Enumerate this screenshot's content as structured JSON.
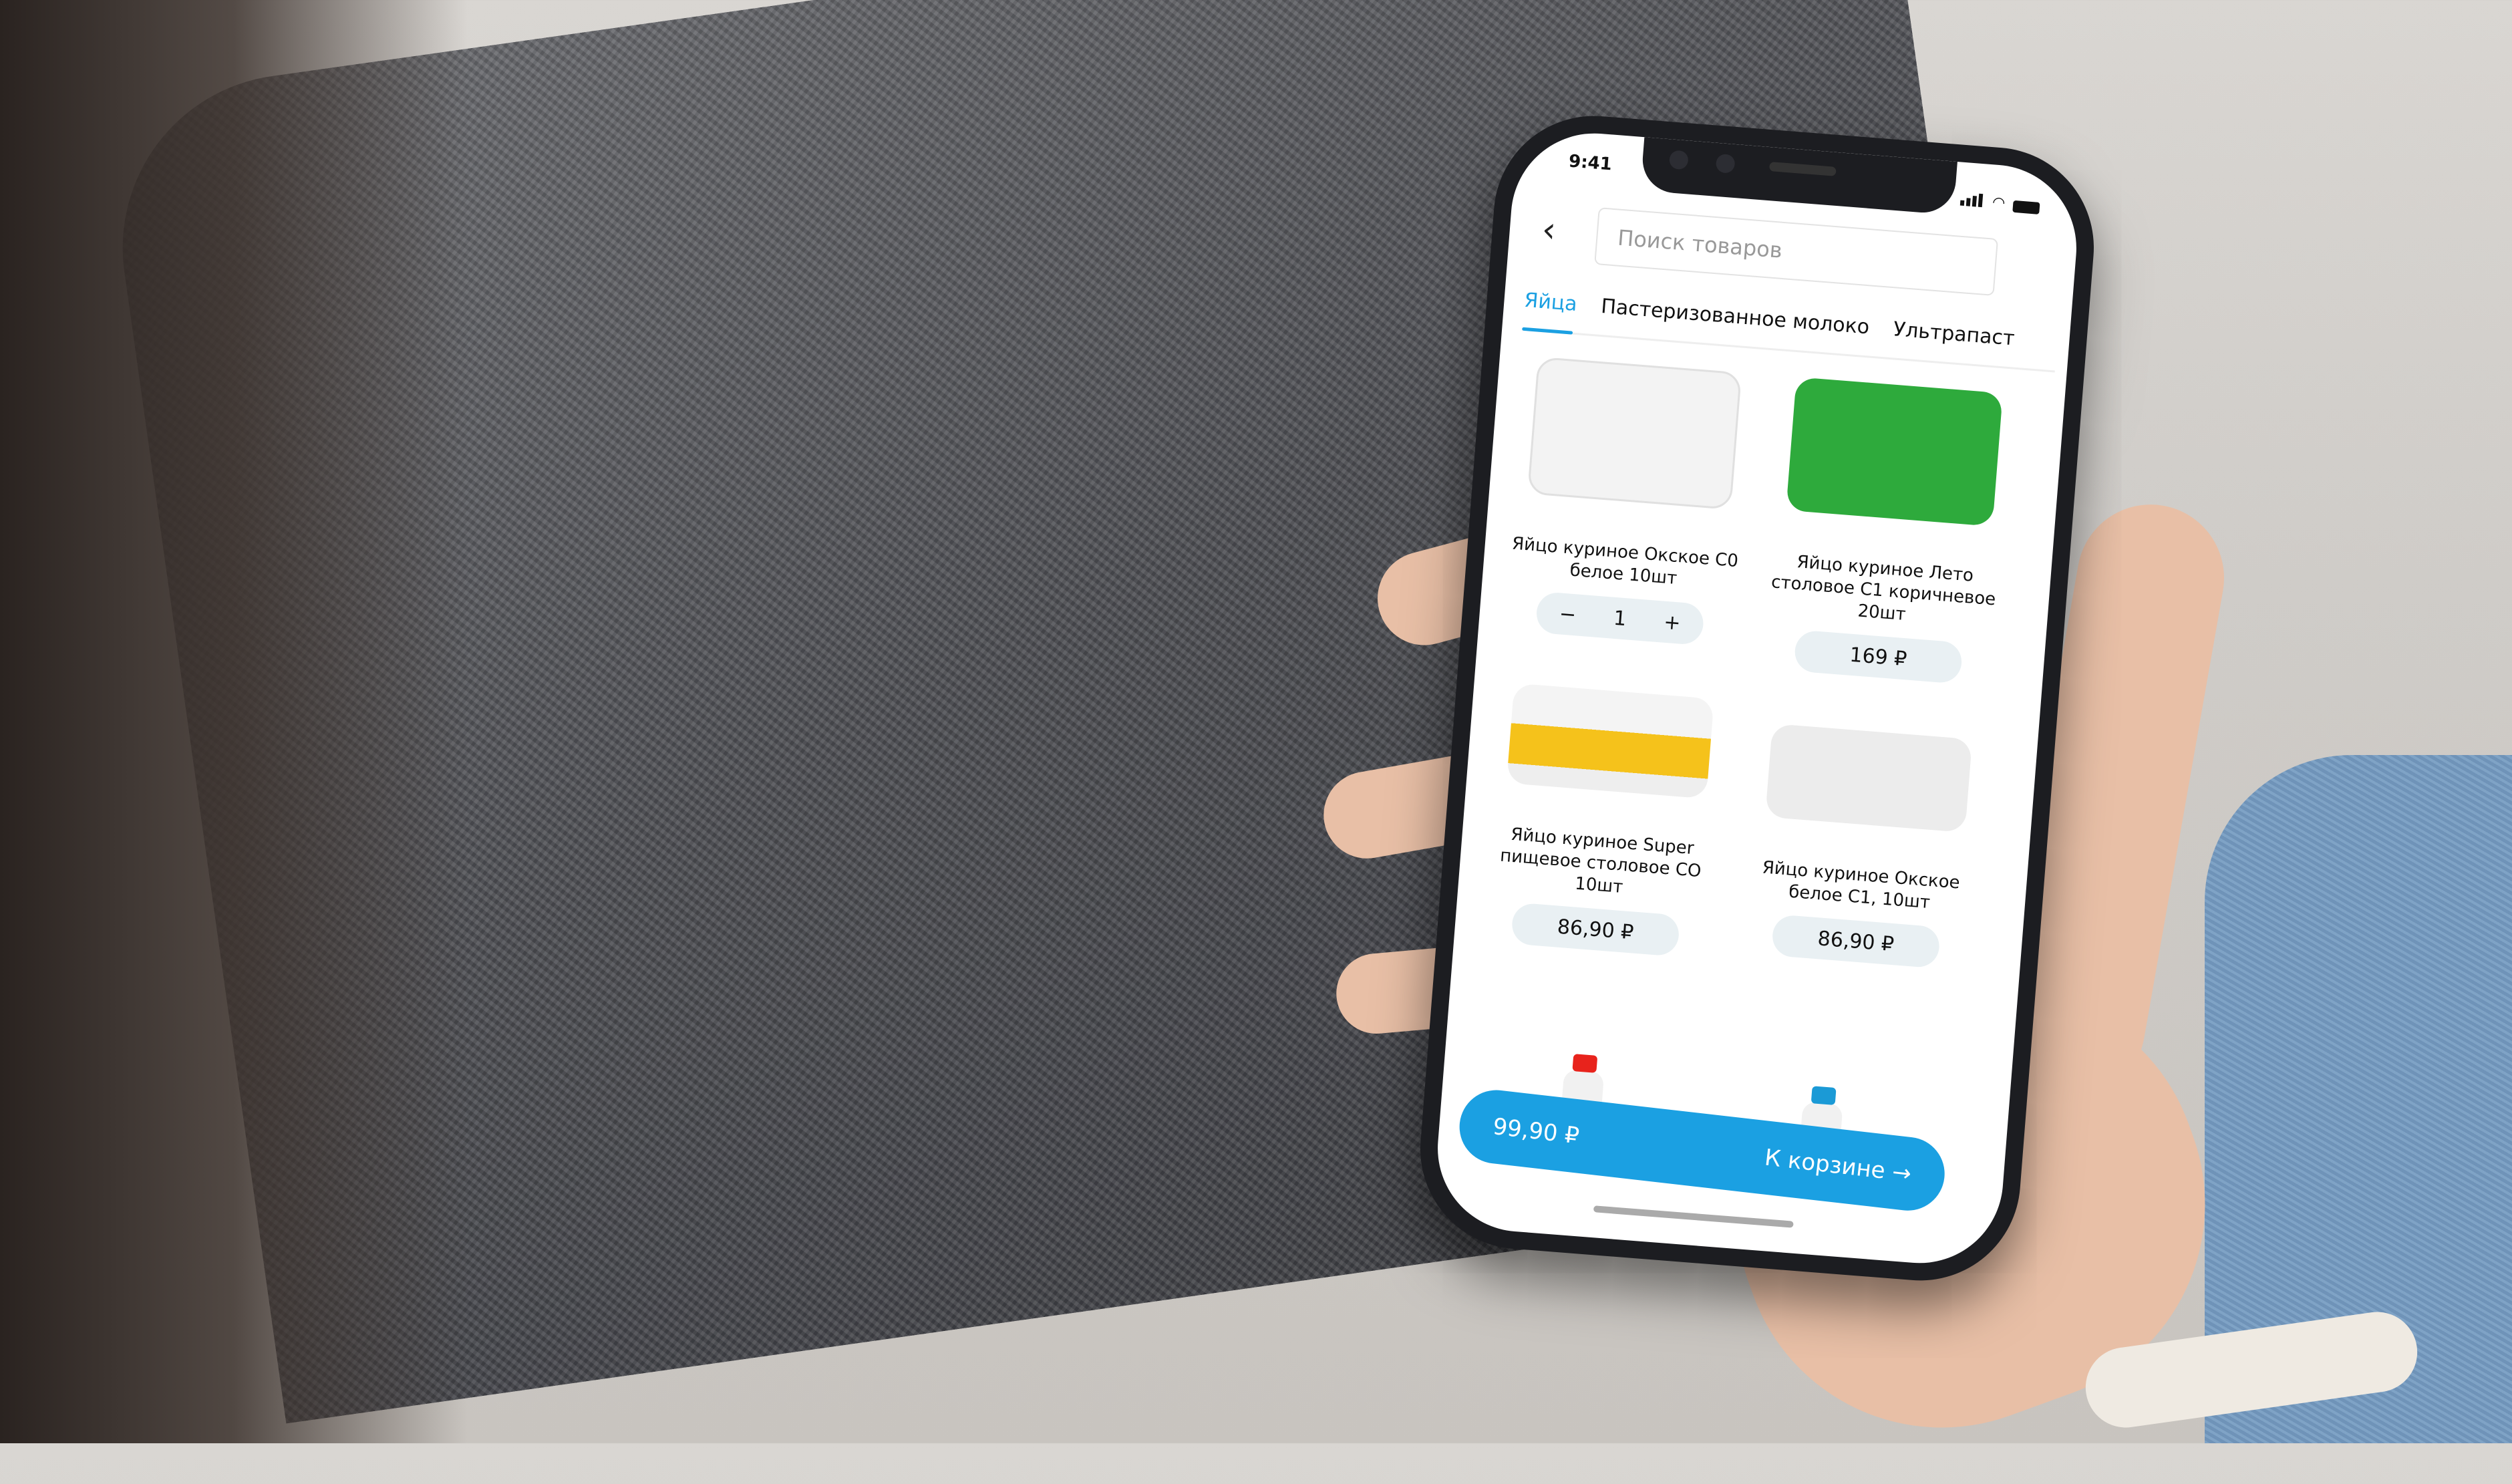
{
  "status_bar": {
    "time": "9:41"
  },
  "search": {
    "placeholder": "Поиск товаров"
  },
  "tabs": [
    {
      "label": "Яйца",
      "active": true
    },
    {
      "label": "Пастеризованное молоко"
    },
    {
      "label": "Ультрапаст"
    }
  ],
  "products": [
    {
      "name": "Яйцо куриное Окское С0 белое 10шт",
      "quantity": "1",
      "minus": "−",
      "plus": "+",
      "image_color": "#ffffff"
    },
    {
      "name": "Яйцо куриное Лето столовое С1 коричневое 20шт",
      "price": "169 ₽",
      "image_color": "#2eaa3c"
    },
    {
      "name": "Яйцо куриное Super пищевое столовое СО 10шт",
      "price": "86,90 ₽",
      "image_color": "#f5c21b"
    },
    {
      "name": "Яйцо куриное Окское белое С1, 10шт",
      "price": "86,90 ₽",
      "image_color": "#ececec"
    }
  ],
  "cart": {
    "total": "99,90 ₽",
    "label": "К корзине",
    "arrow": "→"
  },
  "accent": "#1ba0e2"
}
